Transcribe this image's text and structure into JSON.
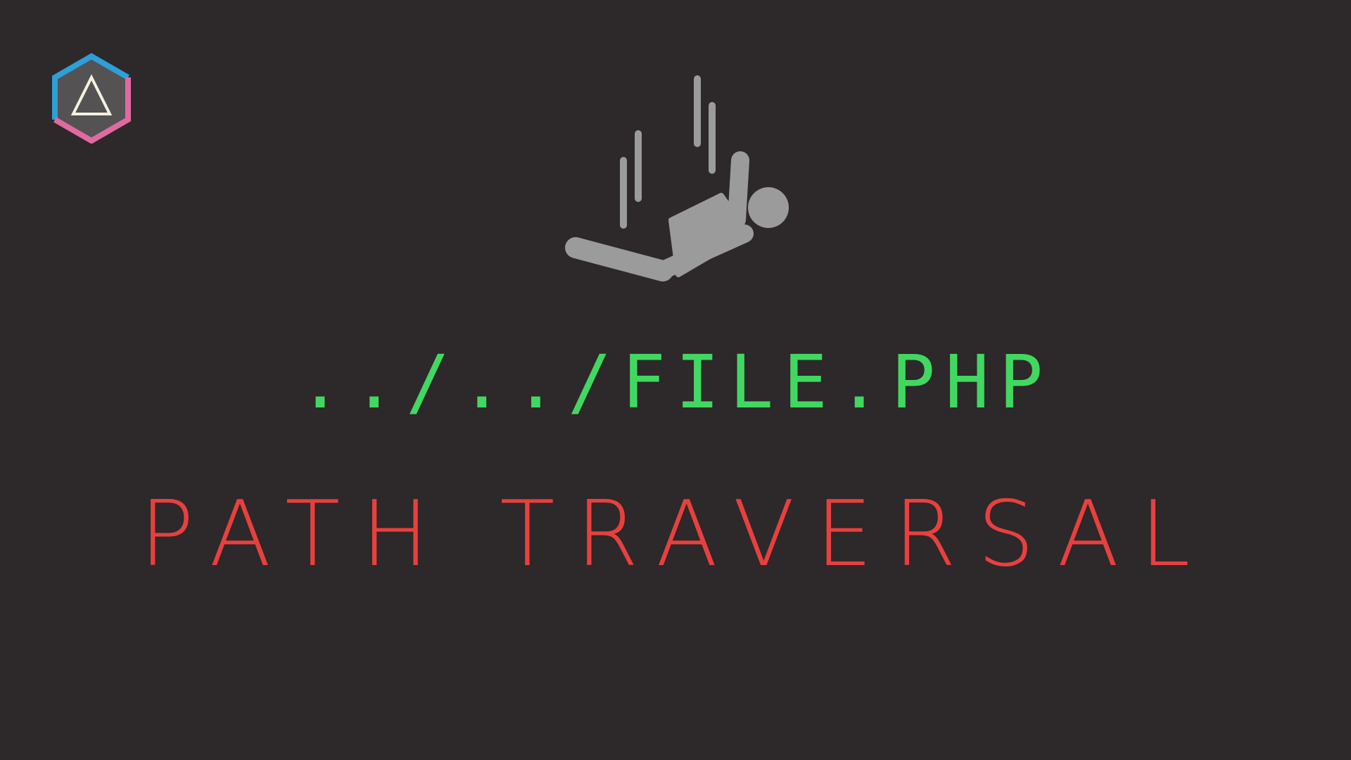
{
  "brand": {
    "logo_icon": "hexagon-triangle-icon",
    "colors": {
      "hex_blue": "#2e9fd8",
      "hex_pink": "#e06aa0",
      "hex_fill": "#545252",
      "triangle": "#f4f1de"
    }
  },
  "illustration": {
    "icon": "falling-person-icon",
    "color": "#9b9b9b"
  },
  "path_string": {
    "text": "../../FILE.PHP",
    "color": "#41d862"
  },
  "title": {
    "text": "PATH TRAVERSAL",
    "color": "#e8403f"
  },
  "background_color": "#2d2829"
}
